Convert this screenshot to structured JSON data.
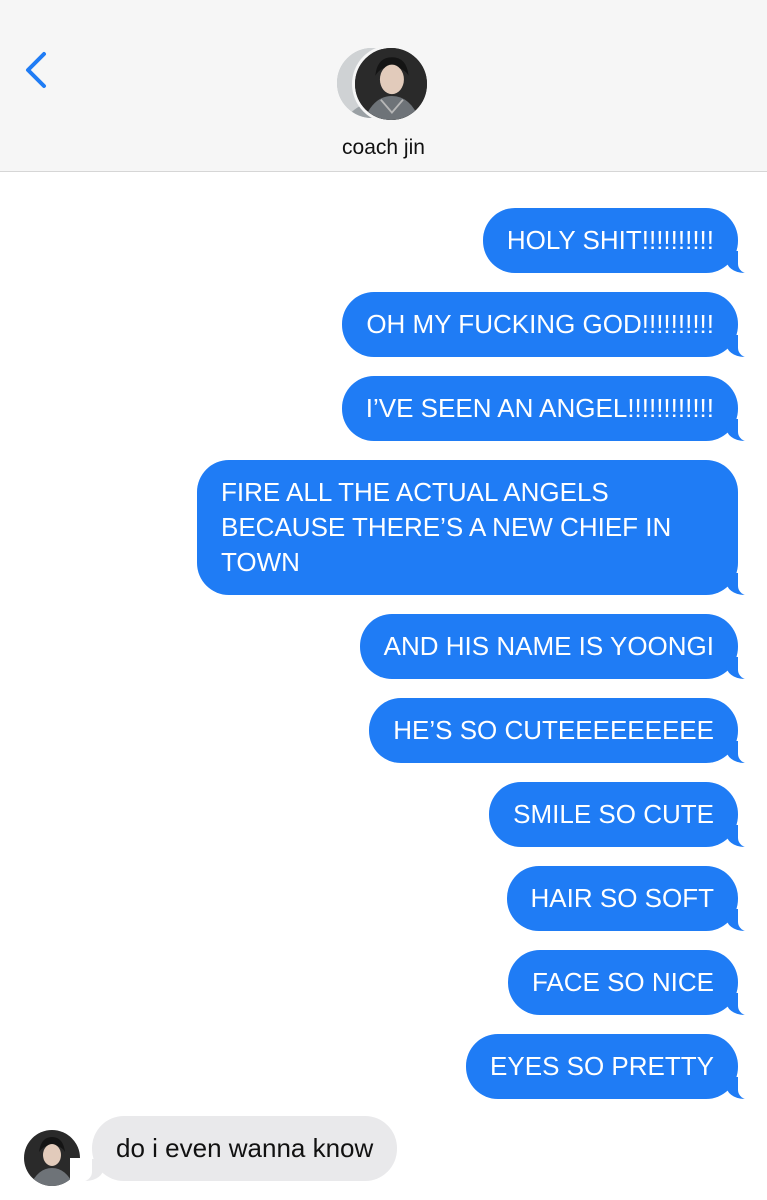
{
  "header": {
    "contact_name": "coach jin",
    "back_icon": "chevron-left-icon",
    "accent_color": "#1f7cf5"
  },
  "messages": [
    {
      "direction": "sent",
      "text": "HOLY SHIT!!!!!!!!!!"
    },
    {
      "direction": "sent",
      "text": "OH MY FUCKING GOD!!!!!!!!!!"
    },
    {
      "direction": "sent",
      "text": "I’VE SEEN AN ANGEL!!!!!!!!!!!!"
    },
    {
      "direction": "sent",
      "text": "FIRE ALL THE ACTUAL ANGELS BECAUSE THERE’S A NEW CHIEF IN TOWN"
    },
    {
      "direction": "sent",
      "text": "AND HIS NAME IS YOONGI"
    },
    {
      "direction": "sent",
      "text": "HE’S SO CUTEEEEEEEEE"
    },
    {
      "direction": "sent",
      "text": "SMILE SO CUTE"
    },
    {
      "direction": "sent",
      "text": "HAIR SO SOFT"
    },
    {
      "direction": "sent",
      "text": "FACE SO NICE"
    },
    {
      "direction": "sent",
      "text": "EYES SO PRETTY"
    },
    {
      "direction": "received",
      "text": "do i even wanna know"
    }
  ],
  "colors": {
    "sent_bubble": "#1f7cf5",
    "received_bubble": "#e9e9eb",
    "header_bg": "#f6f6f6"
  }
}
